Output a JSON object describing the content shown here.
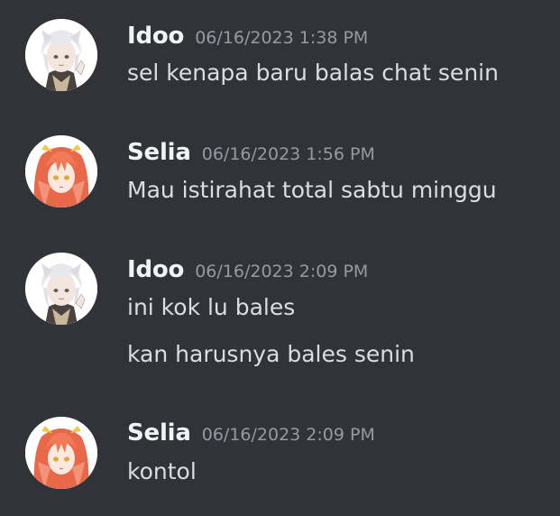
{
  "messages": [
    {
      "author": "Idoo",
      "timestamp": "06/16/2023 1:38 PM",
      "avatar_icon": "white-haired-boy-avatar",
      "lines": [
        "sel kenapa baru balas chat senin"
      ]
    },
    {
      "author": "Selia",
      "timestamp": "06/16/2023 1:56 PM",
      "avatar_icon": "orange-haired-girl-avatar",
      "lines": [
        "Mau istirahat total sabtu minggu"
      ]
    },
    {
      "author": "Idoo",
      "timestamp": "06/16/2023 2:09 PM",
      "avatar_icon": "white-haired-boy-avatar",
      "lines": [
        "ini kok lu bales",
        "kan harusnya bales senin"
      ]
    },
    {
      "author": "Selia",
      "timestamp": "06/16/2023 2:09 PM",
      "avatar_icon": "orange-haired-girl-avatar",
      "lines": [
        "kontol"
      ]
    }
  ],
  "colors": {
    "background": "#313338",
    "username": "#f2f3f5",
    "timestamp": "#949ba4",
    "message_text": "#dbdee1"
  }
}
